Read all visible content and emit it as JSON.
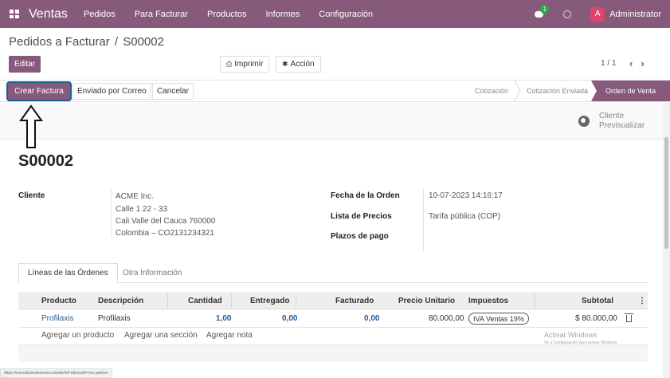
{
  "topbar": {
    "brand": "Ventas",
    "menu": [
      "Pedidos",
      "Para Facturar",
      "Productos",
      "Informes",
      "Configuración"
    ],
    "chat_badge": "1",
    "avatar_letter": "A",
    "username": "Administrator"
  },
  "control": {
    "breadcrumb_parent": "Pedidos a Facturar",
    "breadcrumb_sep": "/",
    "breadcrumb_current": "S00002",
    "edit_label": "Editar",
    "print_label": "Imprimir",
    "action_label": "Acción",
    "pager": "1 / 1"
  },
  "statusbar": {
    "create_invoice": "Crear Factura",
    "send_email": "Enviado por Correo",
    "cancel": "Cancelar",
    "stages": [
      "Cotización",
      "Cotización Enviada",
      "Orden de Venta"
    ],
    "active_stage": "Orden de Venta"
  },
  "preview": {
    "line1": "Cliente",
    "line2": "Previsualizar"
  },
  "order": {
    "name": "S00002",
    "customer_label": "Cliente",
    "customer_lines": [
      "ACME Inc.",
      "Calle 1 22 - 33",
      "Cali Valle del Cauca 760000",
      "Colombia – CO2131234321"
    ],
    "date_label": "Fecha de la Orden",
    "date_value": "10-07-2023 14:16:17",
    "pricelist_label": "Lista de Precios",
    "pricelist_value": "Tarifa pública (COP)",
    "terms_label": "Plazos de pago"
  },
  "tabs": [
    "Líneas de las Órdenes",
    "Otra Información"
  ],
  "table": {
    "headers": [
      "Producto",
      "Descripción",
      "Cantidad",
      "Entregado",
      "Facturado",
      "Precio Unitario",
      "Impuestos",
      "Subtotal"
    ],
    "row": {
      "product": "Profilaxis",
      "description": "Profilaxis",
      "quantity": "1,00",
      "delivered": "0,00",
      "invoiced": "0,00",
      "unit_price": "80.000,00",
      "tax": "IVA Ventas 19%",
      "subtotal": "$ 80.000,00"
    },
    "add_product": "Agregar un producto",
    "add_section": "Agregar una sección",
    "add_note": "Agregar nota"
  },
  "watermark": {
    "line1": "Activar Windows",
    "line2": "Ve a Configuración para activar Windows."
  },
  "status_url": "https://consultoriodeventa.co/web#id=2&model=res.partner",
  "colors": {
    "brand": "#875a7b",
    "avatar": "#e0436b",
    "badge": "#28a745"
  }
}
